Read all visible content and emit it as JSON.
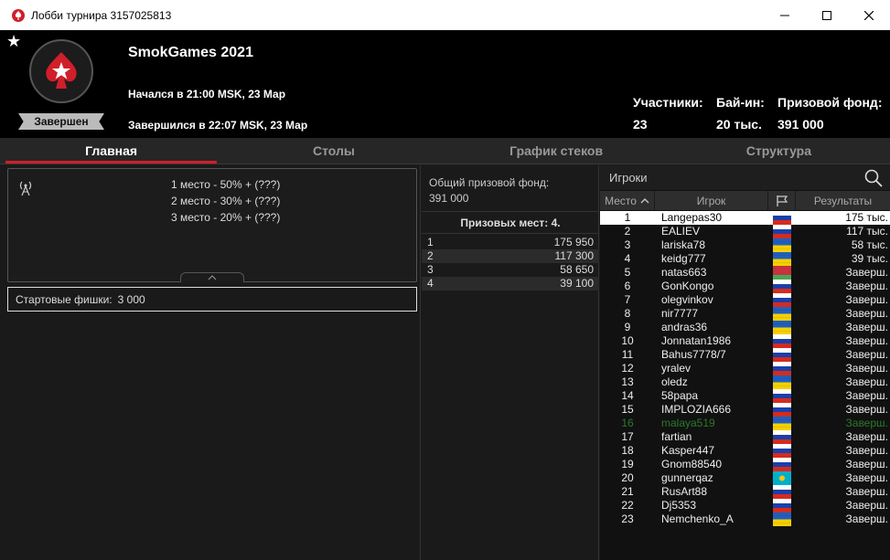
{
  "window": {
    "title": "Лобби турнира 3157025813"
  },
  "header": {
    "tournament_name": "SmokGames 2021",
    "started": "Начался в 21:00 MSK, 23 Мар",
    "ended": "Завершился в 22:07 MSK, 23 Мар",
    "status": "Завершен",
    "participants_label": "Участники:",
    "participants_value": "23",
    "buyin_label": "Бай-ин:",
    "buyin_value": "20 тыс.",
    "prize_label": "Призовой фонд:",
    "prize_value": "391 000"
  },
  "tabs": [
    {
      "label": "Главная",
      "active": true
    },
    {
      "label": "Столы",
      "active": false
    },
    {
      "label": "График стеков",
      "active": false
    },
    {
      "label": "Структура",
      "active": false
    }
  ],
  "payouts": [
    "1 место - 50% + (???)",
    "2 место - 30% + (???)",
    "3 место - 20% + (???)"
  ],
  "chips": {
    "label": "Стартовые фишки:",
    "value": "3 000"
  },
  "prize_pool": {
    "label": "Общий призовой фонд:",
    "value": "391 000",
    "places_label": "Призовых мест: 4.",
    "places": [
      {
        "place": "1",
        "amount": "175 950"
      },
      {
        "place": "2",
        "amount": "117 300"
      },
      {
        "place": "3",
        "amount": "58 650"
      },
      {
        "place": "4",
        "amount": "39 100"
      }
    ]
  },
  "players": {
    "title": "Игроки",
    "col_place": "Место",
    "col_player": "Игрок",
    "col_result": "Результаты",
    "rows": [
      {
        "place": "1",
        "name": "Langepas30",
        "flag": "ru",
        "result": "175 тыс."
      },
      {
        "place": "2",
        "name": "EALIEV",
        "flag": "ru",
        "result": "117 тыс."
      },
      {
        "place": "3",
        "name": "lariska78",
        "flag": "ua",
        "result": "58 тыс."
      },
      {
        "place": "4",
        "name": "keidg777",
        "flag": "ua",
        "result": "39 тыс."
      },
      {
        "place": "5",
        "name": "natas663",
        "flag": "by",
        "result": "Заверш."
      },
      {
        "place": "6",
        "name": "GonKongo",
        "flag": "ru",
        "result": "Заверш."
      },
      {
        "place": "7",
        "name": "olegvinkov",
        "flag": "ru",
        "result": "Заверш."
      },
      {
        "place": "8",
        "name": "nir7777",
        "flag": "ua",
        "result": "Заверш."
      },
      {
        "place": "9",
        "name": "andras36",
        "flag": "ua",
        "result": "Заверш."
      },
      {
        "place": "10",
        "name": "Jonnatan1986",
        "flag": "ru",
        "result": "Заверш."
      },
      {
        "place": "11",
        "name": "Bahus7778/7",
        "flag": "ru",
        "result": "Заверш."
      },
      {
        "place": "12",
        "name": "yralev",
        "flag": "ru",
        "result": "Заверш."
      },
      {
        "place": "13",
        "name": "oledz",
        "flag": "ua",
        "result": "Заверш."
      },
      {
        "place": "14",
        "name": "58papa",
        "flag": "ru",
        "result": "Заверш."
      },
      {
        "place": "15",
        "name": "IMPLOZIA666",
        "flag": "ru",
        "result": "Заверш."
      },
      {
        "place": "16",
        "name": "malaya519",
        "flag": "ua",
        "result": "Заверш."
      },
      {
        "place": "17",
        "name": "fartian",
        "flag": "ru",
        "result": "Заверш."
      },
      {
        "place": "18",
        "name": "Kasper447",
        "flag": "ru",
        "result": "Заверш."
      },
      {
        "place": "19",
        "name": "Gnom88540",
        "flag": "ru",
        "result": "Заверш."
      },
      {
        "place": "20",
        "name": "gunnerqaz",
        "flag": "kz",
        "result": "Заверш."
      },
      {
        "place": "21",
        "name": "RusArt88",
        "flag": "ru",
        "result": "Заверш."
      },
      {
        "place": "22",
        "name": "Dj5353",
        "flag": "ru",
        "result": "Заверш."
      },
      {
        "place": "23",
        "name": "Nemchenko_A",
        "flag": "ua",
        "result": "Заверш."
      }
    ]
  },
  "colors": {
    "accent": "#d01f2a",
    "highlight_row": "#ffffff",
    "self_row": "#2a7a2a"
  }
}
